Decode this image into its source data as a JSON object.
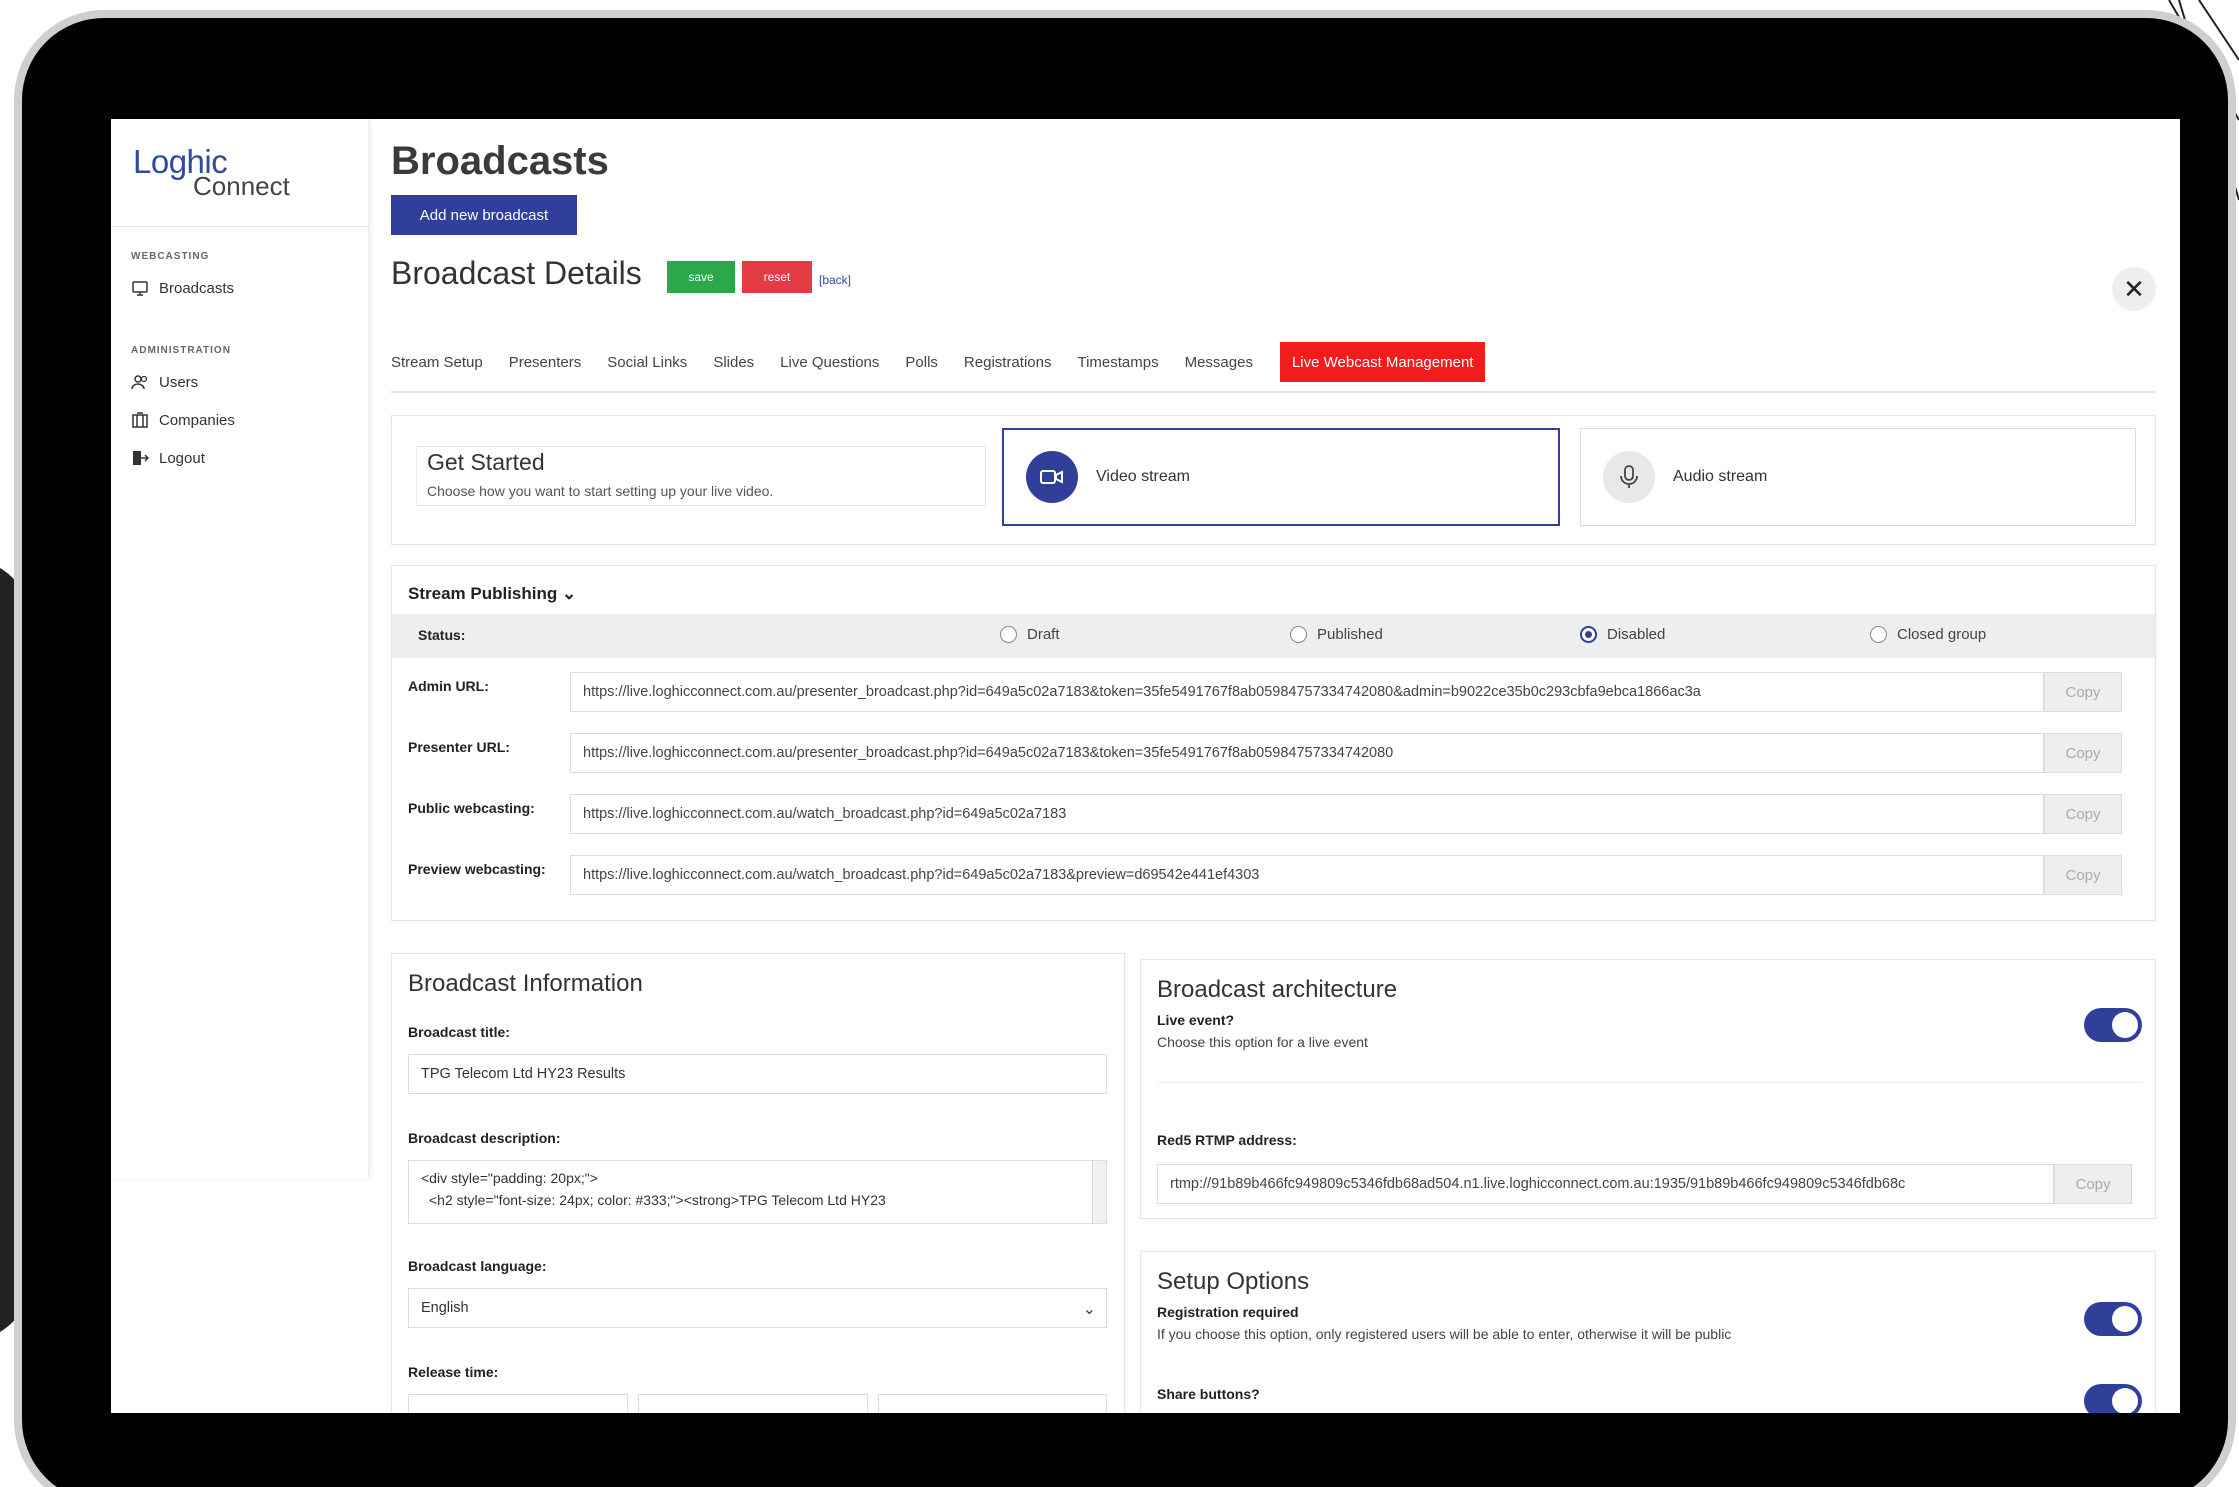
{
  "sidebar": {
    "logo_main": "Loghic",
    "logo_sub": "Connect",
    "sections": [
      {
        "heading": "WEBCASTING",
        "items": [
          {
            "label": "Broadcasts",
            "icon": "monitor-icon"
          }
        ]
      },
      {
        "heading": "ADMINISTRATION",
        "items": [
          {
            "label": "Users",
            "icon": "users-icon"
          },
          {
            "label": "Companies",
            "icon": "building-icon"
          },
          {
            "label": "Logout",
            "icon": "logout-icon"
          }
        ]
      }
    ]
  },
  "header": {
    "title": "Broadcasts",
    "add_button": "Add new broadcast",
    "details_title": "Broadcast Details",
    "save_label": "save",
    "reset_label": "reset",
    "back_label": "[back]",
    "close_glyph": "✕"
  },
  "tabs": [
    {
      "label": "Stream Setup",
      "active": false
    },
    {
      "label": "Presenters",
      "active": false
    },
    {
      "label": "Social Links",
      "active": false
    },
    {
      "label": "Slides",
      "active": false
    },
    {
      "label": "Live Questions",
      "active": false
    },
    {
      "label": "Polls",
      "active": false
    },
    {
      "label": "Registrations",
      "active": false
    },
    {
      "label": "Timestamps",
      "active": false
    },
    {
      "label": "Messages",
      "active": false
    },
    {
      "label": "Live Webcast Management",
      "active": true
    }
  ],
  "get_started": {
    "title": "Get Started",
    "subtitle": "Choose how you want to start setting up your live video.",
    "options": [
      {
        "label": "Video stream",
        "icon": "video-camera-icon",
        "selected": true
      },
      {
        "label": "Audio stream",
        "icon": "microphone-icon",
        "selected": false
      }
    ]
  },
  "publishing": {
    "heading": "Stream Publishing",
    "status_label": "Status:",
    "status_options": [
      {
        "label": "Draft",
        "checked": false
      },
      {
        "label": "Published",
        "checked": false
      },
      {
        "label": "Disabled",
        "checked": true
      },
      {
        "label": "Closed group",
        "checked": false
      }
    ],
    "copy_label": "Copy",
    "urls": [
      {
        "label": "Admin URL:",
        "value": "https://live.loghicconnect.com.au/presenter_broadcast.php?id=649a5c02a7183&token=35fe5491767f8ab05984757334742080&admin=b9022ce35b0c293cbfa9ebca1866ac3a"
      },
      {
        "label": "Presenter URL:",
        "value": "https://live.loghicconnect.com.au/presenter_broadcast.php?id=649a5c02a7183&token=35fe5491767f8ab05984757334742080"
      },
      {
        "label": "Public webcasting:",
        "value": "https://live.loghicconnect.com.au/watch_broadcast.php?id=649a5c02a7183"
      },
      {
        "label": "Preview webcasting:",
        "value": "https://live.loghicconnect.com.au/watch_broadcast.php?id=649a5c02a7183&preview=d69542e441ef4303"
      }
    ]
  },
  "info": {
    "title": "Broadcast Information",
    "title_label": "Broadcast title:",
    "title_value": "TPG Telecom Ltd HY23 Results",
    "description_label": "Broadcast description:",
    "description_line1": "<div style=\"padding: 20px;\">",
    "description_line2": "<h2 style=\"font-size: 24px; color: #333;\"><strong>TPG Telecom Ltd HY23",
    "language_label": "Broadcast language:",
    "language_value": "English",
    "release_label": "Release time:"
  },
  "architecture": {
    "title": "Broadcast architecture",
    "live_title": "Live event?",
    "live_sub": "Choose this option for a live event",
    "live_on": true,
    "rtmp_label": "Red5 RTMP address:",
    "rtmp_value": "rtmp://91b89b466fc949809c5346fdb68ad504.n1.live.loghicconnect.com.au:1935/91b89b466fc949809c5346fdb68c",
    "copy_label": "Copy"
  },
  "setup": {
    "title": "Setup Options",
    "reg_title": "Registration required",
    "reg_sub": "If you choose this option, only registered users will be able to enter, otherwise it will be public",
    "reg_on": true,
    "share_title": "Share buttons?",
    "share_on": true
  },
  "colors": {
    "primary": "#2f3f9a",
    "save": "#2aa84a",
    "reset": "#e33a44",
    "active_tab": "#f21c1c"
  }
}
